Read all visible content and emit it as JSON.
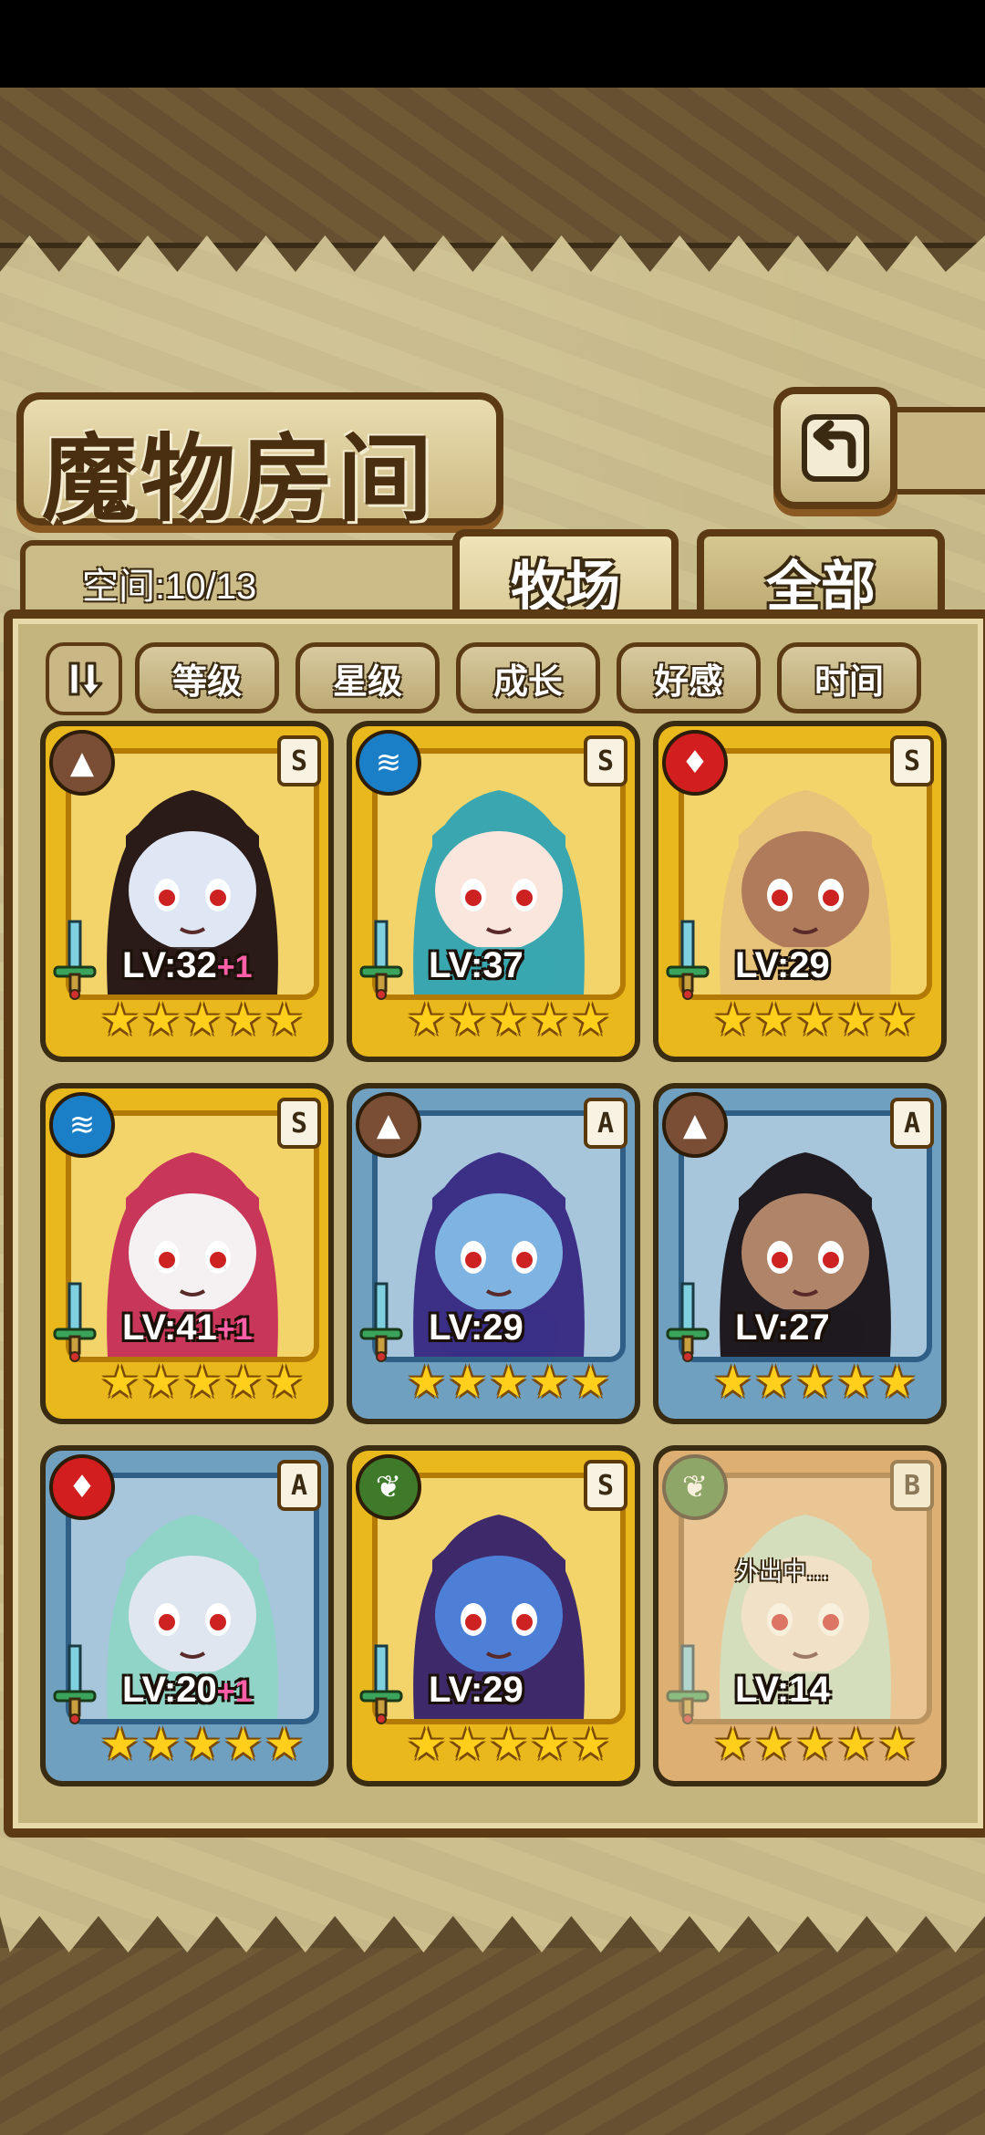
{
  "header": {
    "title": "魔物房间",
    "back_icon": "return-icon",
    "capacity_text": "空间:10/13"
  },
  "tabs": [
    {
      "label": "牧场",
      "active": true
    },
    {
      "label": "全部",
      "active": false
    }
  ],
  "sort": {
    "toggle_icon": "sort-order-icon",
    "buttons": [
      {
        "label": "等级"
      },
      {
        "label": "星级"
      },
      {
        "label": "成长"
      },
      {
        "label": "好感"
      },
      {
        "label": "时间"
      }
    ]
  },
  "monsters": [
    {
      "element": "earth",
      "element_icon": "mountain-icon",
      "grade": "S",
      "level": "LV:32",
      "bonus": "+1",
      "stars": 5,
      "frame": "gold",
      "skin": "#dfe6f4",
      "hair": "#2a1a18",
      "status": ""
    },
    {
      "element": "water",
      "element_icon": "water-wave-icon",
      "grade": "S",
      "level": "LV:37",
      "bonus": "",
      "stars": 5,
      "frame": "gold",
      "skin": "#fbe6de",
      "hair": "#3aa7b0",
      "status": ""
    },
    {
      "element": "fire",
      "element_icon": "flame-icon",
      "grade": "S",
      "level": "LV:29",
      "bonus": "",
      "stars": 5,
      "frame": "gold",
      "skin": "#b07b5a",
      "hair": "#e8c37a",
      "status": ""
    },
    {
      "element": "water",
      "element_icon": "water-wave-icon",
      "grade": "S",
      "level": "LV:41",
      "bonus": "+1",
      "stars": 5,
      "frame": "gold",
      "skin": "#f5f0f2",
      "hair": "#c8365a",
      "status": ""
    },
    {
      "element": "earth",
      "element_icon": "mountain-icon",
      "grade": "A",
      "level": "LV:29",
      "bonus": "",
      "stars": 5,
      "frame": "blue",
      "skin": "#7fb3e2",
      "hair": "#3b2f86",
      "status": ""
    },
    {
      "element": "earth",
      "element_icon": "mountain-icon",
      "grade": "A",
      "level": "LV:27",
      "bonus": "",
      "stars": 5,
      "frame": "blue",
      "skin": "#b08468",
      "hair": "#1e1a20",
      "status": ""
    },
    {
      "element": "fire",
      "element_icon": "flame-icon",
      "grade": "A",
      "level": "LV:20",
      "bonus": "+1",
      "stars": 5,
      "frame": "blue",
      "skin": "#dfe6f0",
      "hair": "#8fd4c6",
      "status": ""
    },
    {
      "element": "wind",
      "element_icon": "leaf-icon",
      "grade": "S",
      "level": "LV:29",
      "bonus": "",
      "stars": 5,
      "frame": "gold",
      "skin": "#4d7fd6",
      "hair": "#3e2a6a",
      "status": ""
    },
    {
      "element": "wind",
      "element_icon": "leaf-icon",
      "grade": "B",
      "level": "LV:14",
      "bonus": "",
      "stars": 5,
      "frame": "bronze",
      "skin": "#f2e6d8",
      "hair": "#bfe0c4",
      "status": "外出中..."
    }
  ]
}
